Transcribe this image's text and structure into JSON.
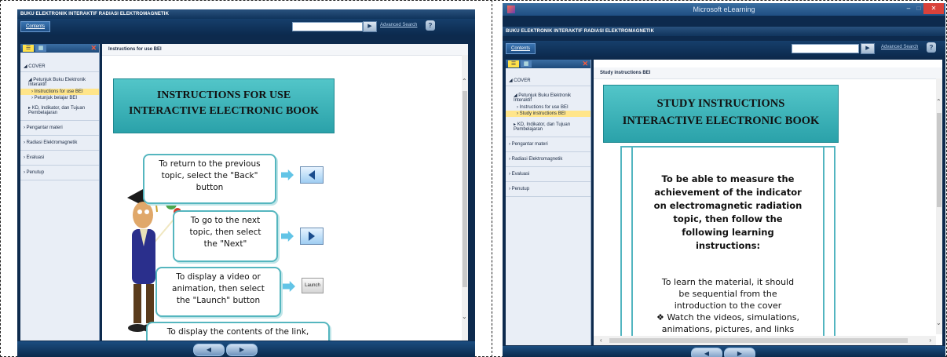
{
  "left": {
    "app_title": "BUKU ELEKTRONIK INTERAKTIF RADIASI ELEKTROMAGNETIK",
    "toolbar": {
      "contents_label": "Contents",
      "search_value": "",
      "search_go": "▶",
      "advanced_search": "Advanced Search",
      "help": "?"
    },
    "sidebar": {
      "cover": "COVER",
      "petunjuk": "Petunjuk Buku Elektronik Interaktif",
      "sub1": "Instructions for use BEI",
      "sub2": "Petunjuk belajar BEI",
      "kd": "KD, Indikator, dan Tujuan Pembelajaran",
      "items": [
        "Pengantar materi",
        "Radiasi Elektromagnetik",
        "Evaluasi",
        "Penutup"
      ]
    },
    "content": {
      "title": "Instructions for use BEI",
      "banner_line1": "INSTRUCTIONS FOR USE",
      "banner_line2": "INTERACTIVE ELECTRONIC BOOK",
      "bubble1": [
        "To return to the previous",
        "topic, select the \"Back\"",
        "button"
      ],
      "bubble2": [
        "To go to the next",
        "topic, then select",
        "the \"Next\""
      ],
      "bubble3": [
        "To display a video or",
        "animation, then select",
        "the \"Launch\" button"
      ],
      "bubble4": "To display the contents of the link,",
      "launch_label": "Launch"
    },
    "nav_back": "◀",
    "nav_next": "▶"
  },
  "right": {
    "window_title": "Microsoft eLearning",
    "app_title": "BUKU ELEKTRONIK INTERAKTIF RADIASI ELEKTROMAGNETIK",
    "window_controls": {
      "minimize": "–",
      "maximize": "□",
      "close": "✕"
    },
    "toolbar": {
      "contents_label": "Contents",
      "search_value": "",
      "search_go": "▶",
      "advanced_search": "Advanced Search",
      "help": "?"
    },
    "sidebar": {
      "cover": "COVER",
      "petunjuk": "Petunjuk Buku Elektronik Interaktif",
      "sub1": "Instructions for use BEI",
      "sub2": "Study instructions BEI",
      "kd": "KD, Indikator, dan Tujuan Pembelajaran",
      "items": [
        "Pengantar materi",
        "Radiasi Elektromagnetik",
        "Evaluasi",
        "Penutup"
      ]
    },
    "content": {
      "title": "Study instructions BEI",
      "banner_line1": "STUDY  INSTRUCTIONS",
      "banner_line2": "INTERACTIVE ELECTRONIC BOOK",
      "heading": [
        "To be able to measure the",
        "achievement of the indicator",
        "on electromagnetic radiation",
        "topic, then follow the",
        "following learning",
        "instructions:"
      ],
      "para": [
        "To learn the material, it should",
        "be sequential from the",
        "introduction to the cover"
      ],
      "bullet": [
        "❖ Watch the videos, simulations,",
        "animations, pictures, and links"
      ]
    },
    "nav_back": "◀",
    "nav_next": "▶"
  },
  "colors": {
    "chrome": "#0d2a4d",
    "teal": "#3bb4ba",
    "highlight": "#ffe58a"
  }
}
